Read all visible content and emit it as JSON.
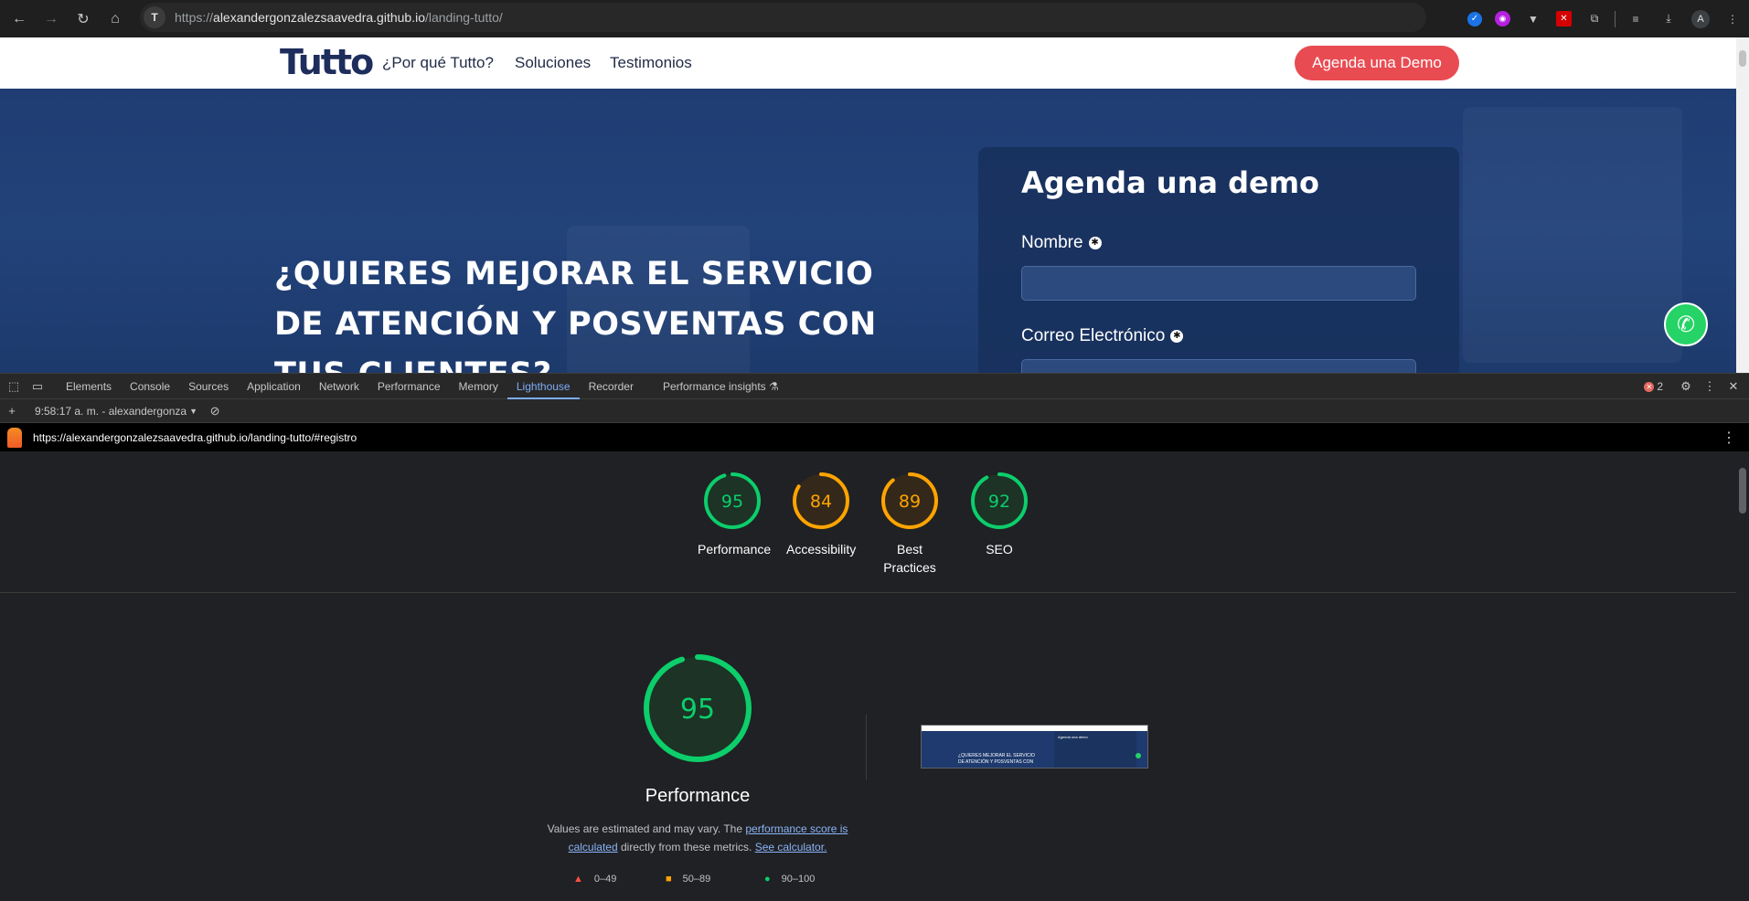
{
  "browser": {
    "url_host": "alexandergonzalezsaavedra.github.io",
    "url_prefix": "https://",
    "url_path": "/landing-tutto/",
    "profile_initial": "A",
    "icons": [
      "back-icon",
      "forward-icon",
      "reload-icon",
      "home-icon"
    ]
  },
  "site": {
    "logo": "Tutto",
    "nav": [
      "¿Por qué Tutto?",
      "Soluciones",
      "Testimonios"
    ],
    "cta": "Agenda una Demo",
    "hero_title": "¿QUIERES MEJORAR EL SERVICIO DE ATENCIÓN Y POSVENTAS CON TUS CLIENTES?",
    "form_title": "Agenda una demo",
    "field_name_label": "Nombre",
    "field_email_label": "Correo Electrónico"
  },
  "devtools": {
    "tabs": [
      "Elements",
      "Console",
      "Sources",
      "Application",
      "Network",
      "Performance",
      "Memory",
      "Lighthouse",
      "Recorder",
      "Performance insights"
    ],
    "active_tab": "Lighthouse",
    "error_count": "2",
    "report_selector": "9:58:17 a. m. - alexandergonza",
    "report_url": "https://alexandergonzalezsaavedra.github.io/landing-tutto/#registro"
  },
  "lighthouse": {
    "scores": [
      {
        "label": "Performance",
        "score": 95,
        "color": "#0cce6b"
      },
      {
        "label": "Accessibility",
        "score": 84,
        "color": "#ffa400"
      },
      {
        "label": "Best Practices",
        "score": 89,
        "color": "#ffa400"
      },
      {
        "label": "SEO",
        "score": 92,
        "color": "#0cce6b"
      }
    ],
    "main_score": 95,
    "main_label": "Performance",
    "desc_before": "Values are estimated and may vary. The ",
    "desc_link1": "performance score is calculated",
    "desc_middle": " directly from these metrics. ",
    "desc_link2": "See calculator.",
    "legend": [
      {
        "range": "0–49",
        "color": "#ff4e42"
      },
      {
        "range": "50–89",
        "color": "#ffa400"
      },
      {
        "range": "90–100",
        "color": "#0cce6b"
      }
    ],
    "thumb_title": "Agenda una demo",
    "thumb_hero": "¿QUIERES MEJORAR EL SERVICIO DE ATENCIÓN Y POSVENTAS CON"
  }
}
